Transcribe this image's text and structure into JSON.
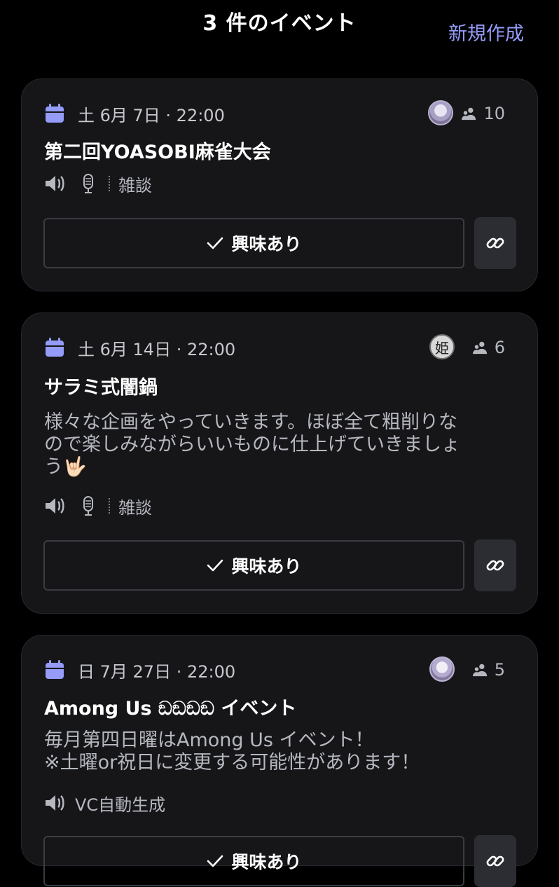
{
  "header": {
    "title": "3 件のイベント",
    "new_label": "新規作成"
  },
  "colors": {
    "accent": "#949cf7",
    "background": "#000000",
    "card": "#161619"
  },
  "events": [
    {
      "date": "土 6月 7日 · 22:00",
      "count": "10",
      "title": "第二回YOASOBI麻雀大会",
      "channel": "雑談",
      "interest_label": "興味あり"
    },
    {
      "date": "土 6月 14日 · 22:00",
      "count": "6",
      "avatar_glyph": "姫",
      "title": "サラミ式闇鍋",
      "description_lines": [
        "様々な企画をやっていきます。ほぼ全て粗削りな",
        "ので楽しみながらいいものに仕上げていきましょ",
        "う🤟🏻"
      ],
      "channel": "雑談",
      "interest_label": "興味あり"
    },
    {
      "date": "日 7月 27日 · 22:00",
      "count": "5",
      "title": "Among Us ඞඞඞඞ イベント",
      "description_lines": [
        "毎月第四日曜はAmong Us イベント！",
        "※土曜or祝日に変更する可能性があります！"
      ],
      "channel": "VC自動生成",
      "interest_label": "興味あり"
    }
  ]
}
